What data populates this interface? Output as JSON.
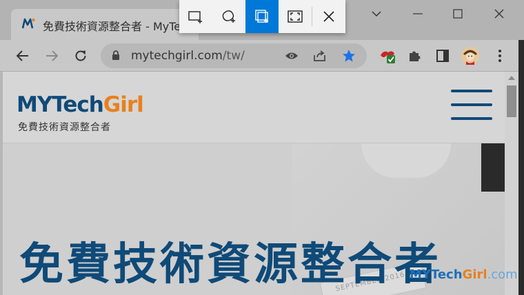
{
  "browser": {
    "tab": {
      "title": "免費技術資源整合者 - MyTec"
    },
    "url": {
      "domain": "mytechgirl.com",
      "path": "/tw/"
    },
    "window_controls": [
      "chevron-down-icon",
      "minimize-icon",
      "maximize-icon",
      "close-icon"
    ]
  },
  "snip": {
    "buttons": [
      {
        "name": "rectangular-snip-button",
        "icon": "rectangle-snip-icon",
        "active": false
      },
      {
        "name": "freeform-snip-button",
        "icon": "freeform-snip-icon",
        "active": false
      },
      {
        "name": "window-snip-button",
        "icon": "window-snip-icon",
        "active": true
      },
      {
        "name": "fullscreen-snip-button",
        "icon": "fullscreen-snip-icon",
        "active": false
      },
      {
        "name": "close-snip-button",
        "icon": "close-icon",
        "active": false
      }
    ],
    "accent": "#0078d7"
  },
  "site": {
    "logo": {
      "my": "MY",
      "tech": "Tech",
      "girl": "Girl",
      "tagline": "免費技術資源整合者"
    },
    "hero_title": "免費技術資源整合者",
    "paper_text": "SEPTEMBER 2016",
    "watermark": {
      "my": "MY",
      "tech": "Tech",
      "girl": "Girl",
      "com": ".com"
    }
  },
  "colors": {
    "brand_blue": "#0f4a78",
    "brand_orange": "#e8801e",
    "star_blue": "#1a73e8"
  }
}
